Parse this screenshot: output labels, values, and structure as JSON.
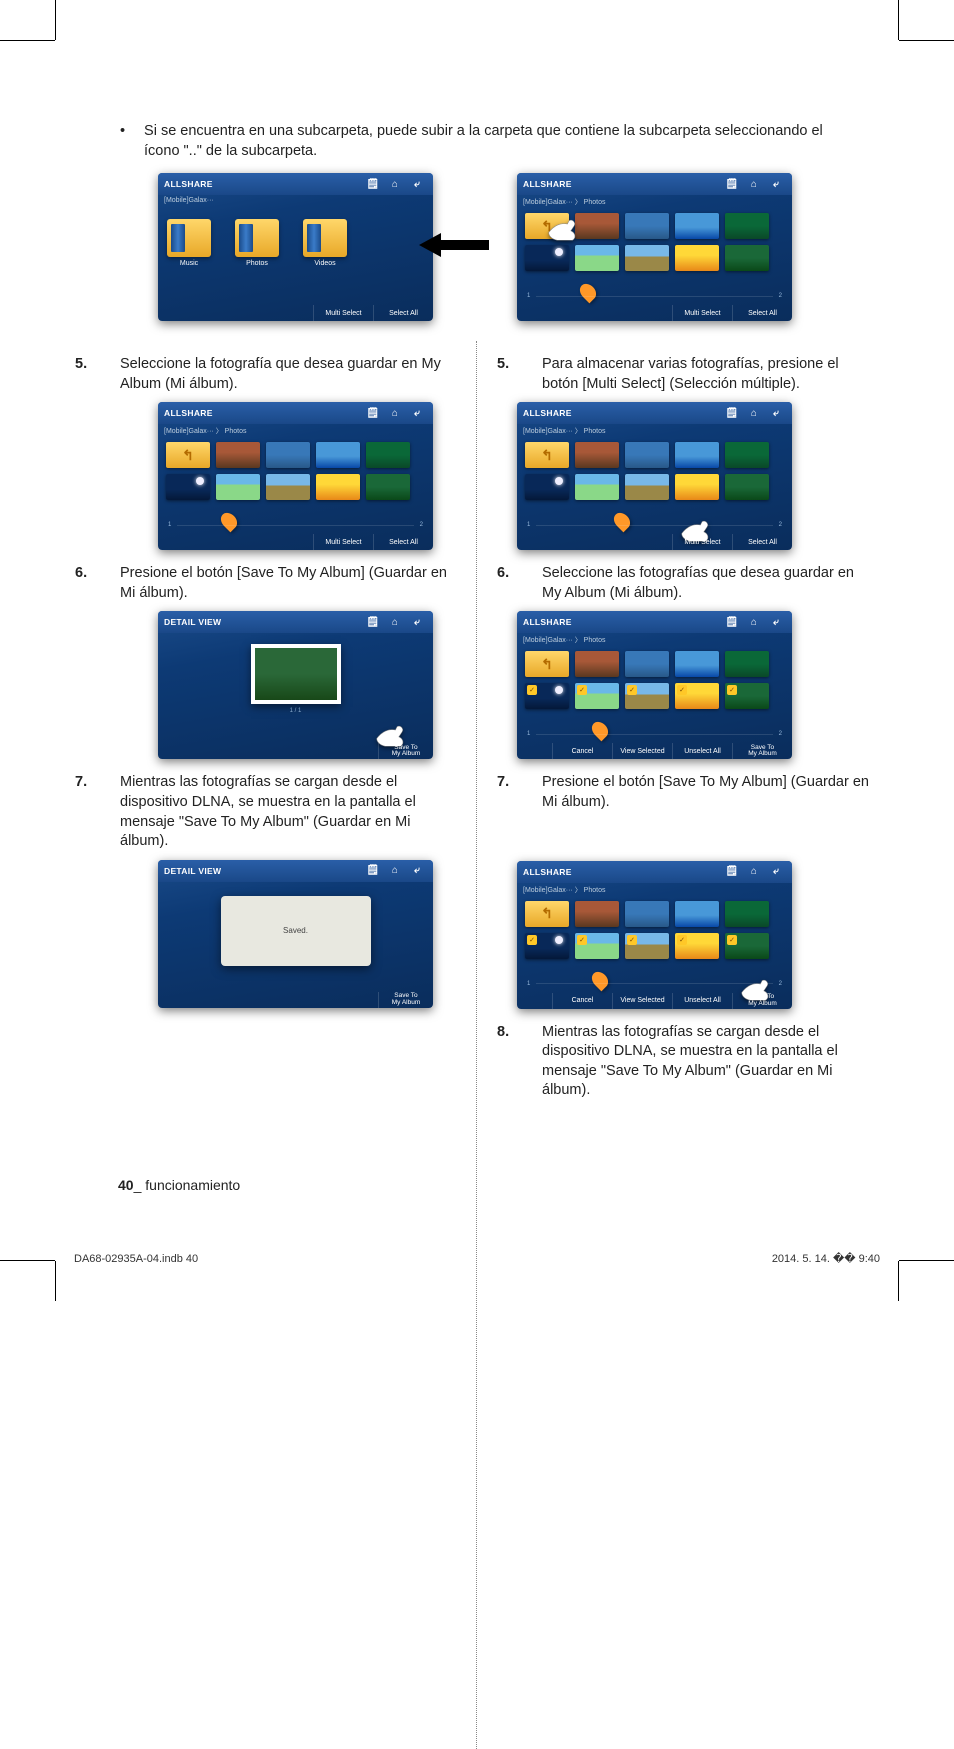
{
  "intro": {
    "bullet": "•",
    "text": "Si se encuentra en una subcarpeta, puede subir a la carpeta que contiene la subcarpeta seleccionando el ícono \"..\" de la subcarpeta."
  },
  "screenshots": {
    "allshare_title": "ALLSHARE",
    "detail_title": "DETAIL VIEW",
    "breadcrumb": "[Mobile]Galax···  〉 Photos",
    "icons": {
      "note": "🗒",
      "home": "⌂",
      "back": "⤶"
    },
    "buttons": {
      "multi_select": "Multi Select",
      "select_all": "Select All",
      "cancel": "Cancel",
      "view_selected": "View Selected",
      "unselect_all": "Unselect All",
      "save_to": "Save To\nMy Album"
    },
    "categories": {
      "music": "Music",
      "photos": "Photos",
      "videos": "Videos"
    },
    "detail_caption": "1 / 1",
    "saved_msg": "Saved.",
    "pager": {
      "left": "1",
      "right": "2"
    },
    "up_icon": "↰"
  },
  "left_steps": {
    "s5": {
      "num": "5.",
      "text": "Seleccione la fotografía que desea guardar en My Album (Mi álbum)."
    },
    "s6": {
      "num": "6.",
      "text": "Presione el botón [Save To My Album] (Guardar en Mi álbum)."
    },
    "s7": {
      "num": "7.",
      "text": "Mientras las fotografías se cargan desde el dispositivo DLNA, se muestra en la pantalla el mensaje \"Save To My Album\" (Guardar en Mi álbum)."
    }
  },
  "right_steps": {
    "s5": {
      "num": "5.",
      "text": "Para almacenar varias fotografías, presione el botón [Multi Select] (Selección múltiple)."
    },
    "s6": {
      "num": "6.",
      "text": "Seleccione las fotografías que desea guardar en My Album (Mi álbum)."
    },
    "s7": {
      "num": "7.",
      "text": "Presione el botón [Save To My Album] (Guardar en Mi álbum)."
    },
    "s8": {
      "num": "8.",
      "text": "Mientras las fotografías se cargan desde el dispositivo DLNA, se muestra en la pantalla el mensaje \"Save To My Album\" (Guardar en Mi álbum)."
    }
  },
  "footer": {
    "page_num": "40",
    "section_sep": "_ ",
    "section": "funcionamiento",
    "indd": "DA68-02935A-04.indb   40",
    "datetime": "2014. 5. 14.   �� 9:40"
  }
}
